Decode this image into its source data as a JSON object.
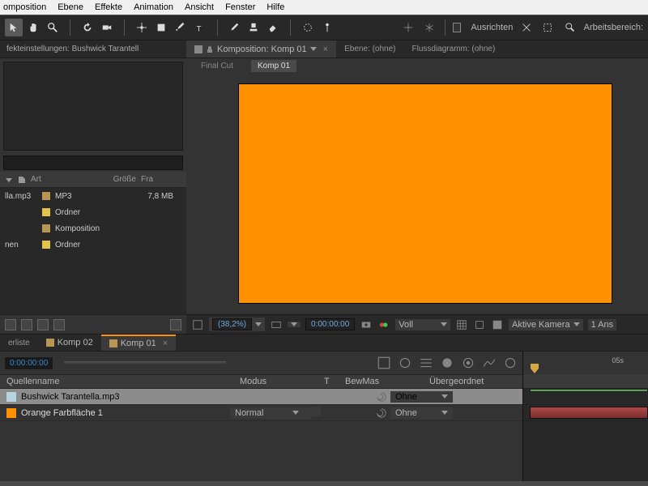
{
  "menu": {
    "items": [
      "omposition",
      "Ebene",
      "Effekte",
      "Animation",
      "Ansicht",
      "Fenster",
      "Hilfe"
    ]
  },
  "toolbar": {
    "align": "Ausrichten",
    "workspace": "Arbeitsbereich:"
  },
  "effects_panel": {
    "title": "fekteinstellungen: Bushwick Tarantell"
  },
  "project": {
    "columns": {
      "art": "Art",
      "size": "Größe",
      "fr": "Fra"
    },
    "items": [
      {
        "name": "lla.mp3",
        "art": "MP3",
        "size": "7,8 MB",
        "iconColor": "#b89455"
      },
      {
        "name": "",
        "art": "Ordner",
        "size": "",
        "iconColor": "#e2c24a"
      },
      {
        "name": "",
        "art": "Komposition",
        "size": "",
        "iconColor": "#b89455"
      },
      {
        "name": "nen",
        "art": "Ordner",
        "size": "",
        "iconColor": "#e2c24a"
      }
    ]
  },
  "comp": {
    "tabs": {
      "composition": "Komposition: Komp 01",
      "layer": "Ebene: (ohne)",
      "flowchart": "Flussdiagramm: (ohne)"
    },
    "subtabs": {
      "finalcut": "Final Cut",
      "komp": "Komp 01"
    }
  },
  "viewer": {
    "zoom": "(38,2%)",
    "timecode": "0:00:00:00",
    "quality": "Voll",
    "camera": "Aktive Kamera",
    "views": "1 Ans"
  },
  "timeline": {
    "tabs": {
      "erliste": "erliste",
      "komp02": "Komp 02",
      "komp01": "Komp 01"
    },
    "timecode": "0:00:00:00",
    "ruler": {
      "t0": "",
      "t1": "05s"
    },
    "headers": {
      "source": "Quellenname",
      "mode": "Modus",
      "t": "T",
      "bewmas": "BewMas",
      "parent": "Übergeordnet"
    },
    "layers": [
      {
        "name": "Bushwick Tarantella.mp3",
        "mode": "",
        "parent": "Ohne",
        "swatch": "swatch-audio",
        "selected": true
      },
      {
        "name": "Orange Farbfläche 1",
        "mode": "Normal",
        "parent": "Ohne",
        "swatch": "swatch-orange",
        "selected": false
      }
    ]
  }
}
